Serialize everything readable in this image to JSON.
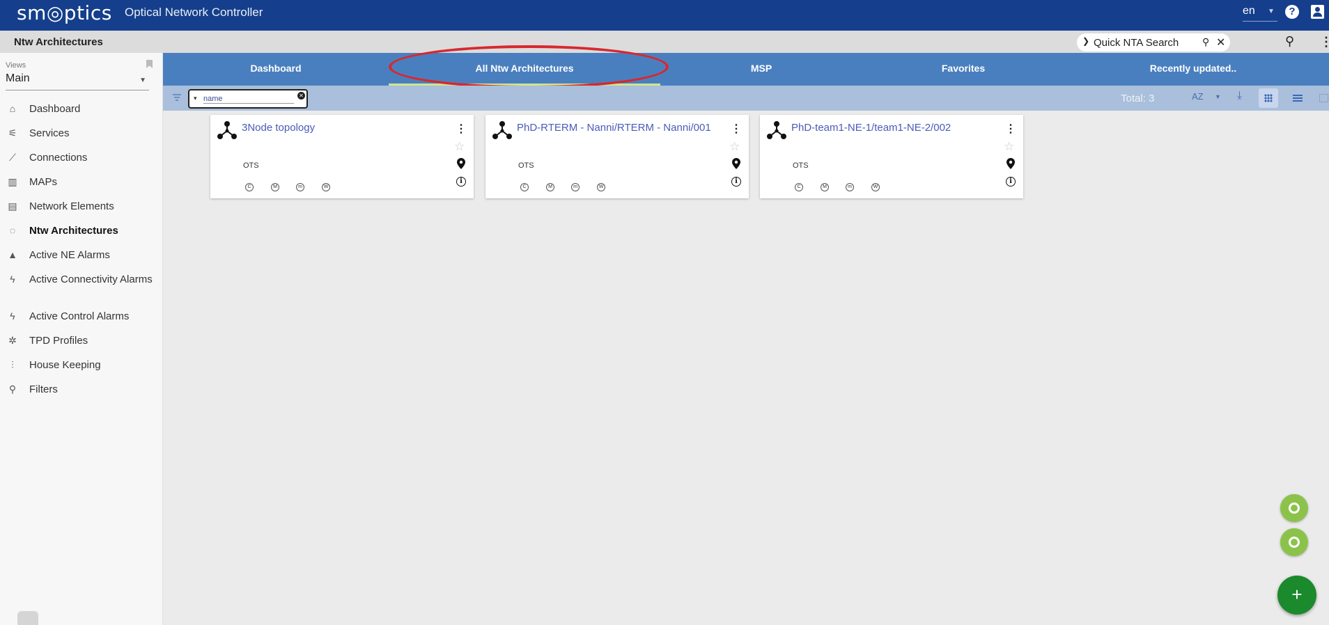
{
  "header": {
    "logo": "sm◎ptics",
    "app_title": "Optical Network Controller",
    "language": "en"
  },
  "subheader": {
    "page_title": "Ntw Architectures",
    "quick_search_placeholder": "Quick NTA Search"
  },
  "sidebar": {
    "views_label": "Views",
    "views_value": "Main",
    "items": [
      {
        "label": "Dashboard",
        "icon": "home-icon"
      },
      {
        "label": "Services",
        "icon": "services-icon"
      },
      {
        "label": "Connections",
        "icon": "connection-line-icon"
      },
      {
        "label": "MAPs",
        "icon": "map-icon"
      },
      {
        "label": "Network Elements",
        "icon": "network-elements-icon"
      },
      {
        "label": "Ntw Architectures",
        "icon": "architecture-icon"
      },
      {
        "label": "Active NE Alarms",
        "icon": "warning-icon"
      },
      {
        "label": "Active Connectivity Alarms",
        "icon": "bolt-icon"
      },
      {
        "label": "Active Control Alarms",
        "icon": "bolt-icon"
      },
      {
        "label": "TPD Profiles",
        "icon": "tpd-icon"
      },
      {
        "label": "House Keeping",
        "icon": "sliders-icon"
      },
      {
        "label": "Filters",
        "icon": "search-icon"
      }
    ]
  },
  "tabs": [
    {
      "label": "Dashboard"
    },
    {
      "label": "All Ntw Architectures"
    },
    {
      "label": "MSP"
    },
    {
      "label": "Favorites"
    },
    {
      "label": "Recently updated.."
    }
  ],
  "filterbar": {
    "filter_value": "name",
    "total": "Total: 3",
    "sort_label": "AZ"
  },
  "cards": [
    {
      "title": "3Node topology",
      "layer": "OTS",
      "badges": [
        "C",
        "M",
        "m",
        "W"
      ]
    },
    {
      "title": "PhD-RTERM - Nanni/RTERM - Nanni/001",
      "layer": "OTS",
      "badges": [
        "C",
        "M",
        "m",
        "W"
      ]
    },
    {
      "title": "PhD-team1-NE-1/team1-NE-2/002",
      "layer": "OTS",
      "badges": [
        "C",
        "M",
        "m",
        "W"
      ]
    }
  ],
  "fab": {
    "add_label": "+"
  },
  "colors": {
    "topbar": "#153f8c",
    "tabs": "#4a7fbf",
    "filterbar": "#a9bfdc",
    "highlight_ellipse": "#d7282f",
    "card_title": "#4a5bb8",
    "fab_green": "#1b8a2c",
    "fab_small": "#8bc34a"
  }
}
